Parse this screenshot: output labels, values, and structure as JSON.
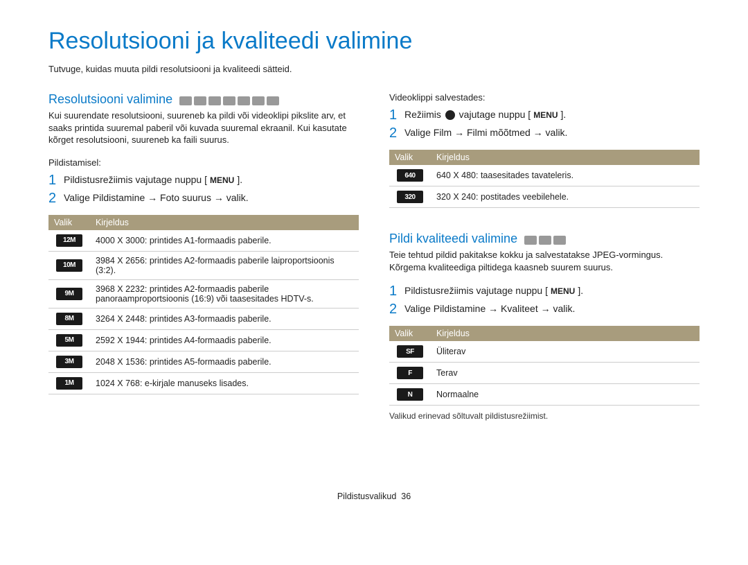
{
  "title": "Resolutsiooni ja kvaliteedi valimine",
  "intro": "Tutvuge, kuidas muuta pildi resolutsiooni ja kvaliteedi sätteid.",
  "left": {
    "heading": "Resolutsiooni valimine",
    "para": "Kui suurendate resolutsiooni, suureneb ka pildi või videoklipi pikslite arv, et saaks printida suuremal paberil või kuvada suuremal ekraanil. Kui kasutate kõrget resolutsiooni, suureneb ka faili suurus.",
    "shooting_label": "Pildistamisel:",
    "step1_a": "Pildistusrežiimis vajutage nuppu [",
    "step1_menu": "MENU",
    "step1_b": "].",
    "step2": "Valige Pildistamine → Foto suurus → valik.",
    "table": {
      "col1": "Valik",
      "col2": "Kirjeldus",
      "rows": [
        {
          "icon": "12M",
          "desc": "4000 X 3000: printides A1-formaadis paberile."
        },
        {
          "icon": "10M",
          "desc": "3984 X 2656: printides A2-formaadis paberile laiproportsioonis (3:2)."
        },
        {
          "icon": "9M",
          "desc": "3968 X 2232: printides A2-formaadis paberile panoraamproportsioonis (16:9) või taasesitades HDTV-s."
        },
        {
          "icon": "8M",
          "desc": "3264 X 2448: printides A3-formaadis paberile."
        },
        {
          "icon": "5M",
          "desc": "2592 X 1944: printides A4-formaadis paberile."
        },
        {
          "icon": "3M",
          "desc": "2048 X 1536: printides A5-formaadis paberile."
        },
        {
          "icon": "1M",
          "desc": "1024 X 768: e-kirjale manuseks lisades."
        }
      ]
    }
  },
  "right": {
    "video_label": "Videoklippi salvestades:",
    "step1_a": "Režiimis ",
    "step1_b": " vajutage nuppu [",
    "step1_menu": "MENU",
    "step1_c": "].",
    "step2": "Valige Film → Filmi mõõtmed → valik.",
    "video_table": {
      "col1": "Valik",
      "col2": "Kirjeldus",
      "rows": [
        {
          "icon": "640",
          "desc": "640 X 480: taasesitades tavateleris."
        },
        {
          "icon": "320",
          "desc": "320 X 240: postitades veebilehele."
        }
      ]
    },
    "quality_heading": "Pildi kvaliteedi valimine",
    "quality_para": "Teie tehtud pildid pakitakse kokku ja salvestatakse JPEG-vormingus. Kõrgema kvaliteediga piltidega kaasneb suurem suurus.",
    "qstep1_a": "Pildistusrežiimis vajutage nuppu [",
    "qstep1_menu": "MENU",
    "qstep1_b": "].",
    "qstep2": "Valige Pildistamine → Kvaliteet → valik.",
    "quality_table": {
      "col1": "Valik",
      "col2": "Kirjeldus",
      "rows": [
        {
          "icon": "SF",
          "desc": "Üliterav"
        },
        {
          "icon": "F",
          "desc": "Terav"
        },
        {
          "icon": "N",
          "desc": "Normaalne"
        }
      ]
    },
    "note": "Valikud erinevad sõltuvalt pildistusrežiimist."
  },
  "footer": {
    "section": "Pildistusvalikud",
    "page": "36"
  }
}
